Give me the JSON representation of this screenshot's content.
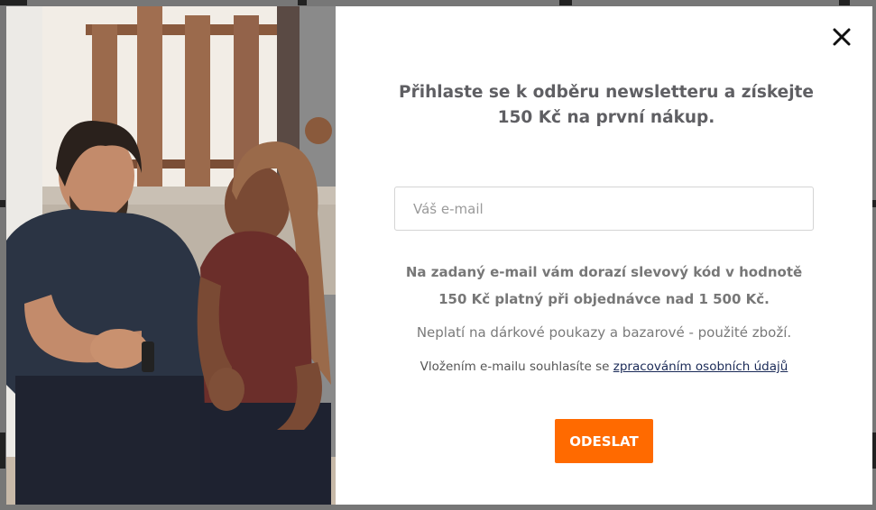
{
  "newsletter_modal": {
    "headline": "Přihlaste se k odběru newsletteru a získejte 150 Kč na první nákup.",
    "email_placeholder": "Váš e-mail",
    "email_value": "",
    "info_text": "Na zadaný e-mail vám dorazí slevový kód v hodnotě 150 Kč platný při objednávce nad 1 500 Kč.",
    "note_text": "Neplatí na dárkové poukazy a bazarové - použité zboží.",
    "consent_prefix": "Vložením e-mailu souhlasíte se ",
    "consent_link": "zpracováním osobních údajů",
    "submit_label": "ODESLAT",
    "close_icon": "close-icon"
  },
  "colors": {
    "accent": "#ff6a00",
    "text": "#6a6a6a",
    "link": "#1a2a57"
  }
}
